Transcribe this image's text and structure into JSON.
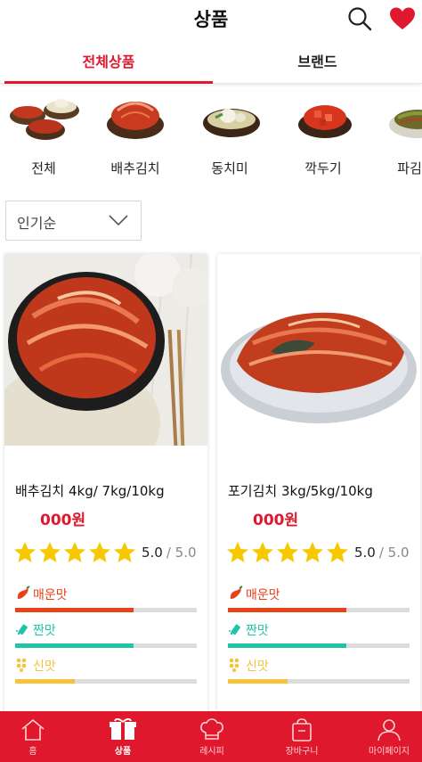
{
  "header": {
    "title": "상품"
  },
  "tabs": [
    {
      "label": "전체상품",
      "active": true
    },
    {
      "label": "브랜드",
      "active": false
    }
  ],
  "categories": [
    {
      "label": "전체",
      "icon": "kimchi-assortment-icon"
    },
    {
      "label": "배추김치",
      "icon": "napa-kimchi-icon"
    },
    {
      "label": "동치미",
      "icon": "dongchimi-icon"
    },
    {
      "label": "깍두기",
      "icon": "kkakdugi-icon"
    },
    {
      "label": "파김치",
      "icon": "pa-kimchi-icon"
    }
  ],
  "sort": {
    "selected": "인기순"
  },
  "products": [
    {
      "name": "배추김치 4kg/ 7kg/10kg",
      "price": "000원",
      "rating": "5.0",
      "rating_max": "/ 5.0",
      "stars": 5,
      "tastes": [
        {
          "label": "매운맛",
          "level": 0.65,
          "color": "#e8421a"
        },
        {
          "label": "짠맛",
          "level": 0.65,
          "color": "#20c4a6"
        },
        {
          "label": "신맛",
          "level": 0.33,
          "color": "#f7c23a"
        }
      ]
    },
    {
      "name": "포기김치 3kg/5kg/10kg",
      "price": "000원",
      "rating": "5.0",
      "rating_max": "/ 5.0",
      "stars": 5,
      "tastes": [
        {
          "label": "매운맛",
          "level": 0.65,
          "color": "#e8421a"
        },
        {
          "label": "짠맛",
          "level": 0.65,
          "color": "#20c4a6"
        },
        {
          "label": "신맛",
          "level": 0.33,
          "color": "#f7c23a"
        }
      ]
    }
  ],
  "bottom_nav": [
    {
      "label": "홈",
      "icon": "home-icon",
      "active": false
    },
    {
      "label": "상품",
      "icon": "gift-box-icon",
      "active": true
    },
    {
      "label": "레시피",
      "icon": "chef-hat-icon",
      "active": false
    },
    {
      "label": "장바구니",
      "icon": "shopping-bag-icon",
      "active": false
    },
    {
      "label": "마이페이지",
      "icon": "user-icon",
      "active": false
    }
  ],
  "colors": {
    "brand": "#e0182d",
    "star": "#f7c800",
    "spicy": "#e8421a",
    "salty": "#20c4a6",
    "sour": "#f7c23a"
  }
}
